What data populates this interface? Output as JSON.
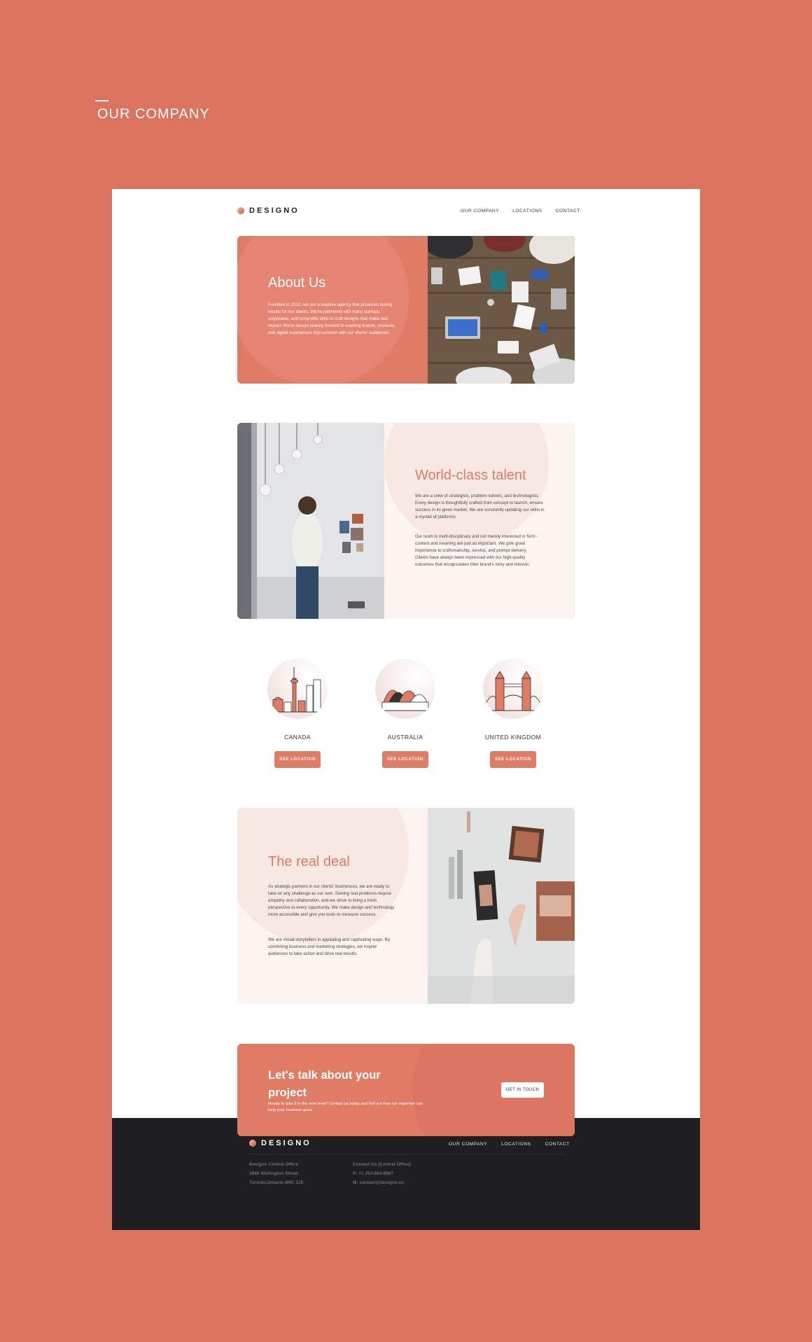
{
  "page": {
    "section_title": "OUR COMPANY"
  },
  "header": {
    "logo_text": "DESIGNO",
    "nav": [
      "OUR COMPANY",
      "LOCATIONS",
      "CONTACT"
    ]
  },
  "about": {
    "heading": "About Us",
    "text": "Founded in 2010, we are a creative agency that produces lasting results for our clients. We've partnered with many startups, corporates, and nonprofits alike to craft designs that make real impact. We're always looking forward to creating brands, products, and digital experiences that connect with our clients' audiences."
  },
  "talent": {
    "heading": "World-class talent",
    "paragraph1": "We are a crew of strategists, problem-solvers, and technologists. Every design is thoughtfully crafted from concept to launch, ensure success in its given market. We are constantly updating our skills in a myriad of platforms.",
    "paragraph2": "Our team is multi-disciplinary and not merely interested in form - content and meaning are just as important. We give great importance to craftsmanship, service, and prompt delivery. Clients have always been impressed with our high-quality outcomes that encapsulates their brand's story and mission."
  },
  "locations": [
    {
      "name": "CANADA",
      "button": "SEE LOCATION",
      "icon": "toronto-skyline-icon"
    },
    {
      "name": "AUSTRALIA",
      "button": "SEE LOCATION",
      "icon": "sydney-opera-house-icon"
    },
    {
      "name": "UNITED KINGDOM",
      "button": "SEE LOCATION",
      "icon": "tower-bridge-icon"
    }
  ],
  "real_deal": {
    "heading": "The real deal",
    "paragraph1": "As strategic partners in our clients' businesses, we are ready to take on any challenge as our own. Solving real problems require empathy and collaboration, and we strive to bring a fresh perspective to every opportunity. We make design and technology more accessible and give you tools to measure success.",
    "paragraph2": "We are visual storytellers in appealing and captivating ways. By combining business and marketing strategies, we inspire audiences to take action and drive real results."
  },
  "cta": {
    "heading_line1": "Let's talk about your",
    "heading_line2": "project",
    "text": "Ready to take it to the next level? Contact us today and find out how our expertise can help your business grow.",
    "button": "GET IN TOUCH"
  },
  "footer": {
    "logo_text": "DESIGNO",
    "nav": [
      "OUR COMPANY",
      "LOCATIONS",
      "CONTACT"
    ],
    "office": [
      "Designo Central Office",
      "3886 Wellington Street",
      "Toronto,Ontario M9C 3J5"
    ],
    "contact": [
      "Contact Us (Central Office)",
      "P: +1 253-863-8967",
      "M: contact@designo.co"
    ]
  },
  "colors": {
    "background": "#DB735E",
    "accent": "#E07B66",
    "peach": "#FDF3F0",
    "dark": "#1F1F21"
  }
}
